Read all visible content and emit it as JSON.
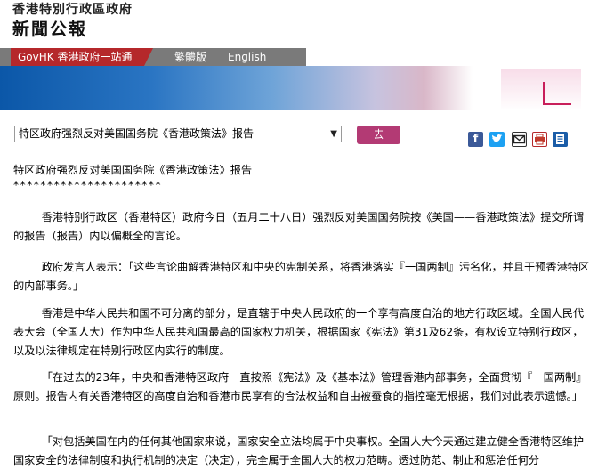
{
  "header": {
    "gov_title": "香港特別行政區政府",
    "press_title": "新聞公報"
  },
  "nav": {
    "govhk": "GovHK 香港政府一站通",
    "trad": "繁體版",
    "english": "English"
  },
  "toolbar": {
    "selected": "特区政府强烈反对美国国务院《香港政策法》报告",
    "go_label": "去"
  },
  "article": {
    "title": "特区政府强烈反对美国国务院《香港政策法》报告",
    "stars": "**********************",
    "paragraphs": [
      "香港特别行政区（香港特区）政府今日（五月二十八日）强烈反对美国国务院按《美国——香港政策法》提交所谓的报告（报告）内以偏概全的言论。",
      "政府发言人表示：「这些言论曲解香港特区和中央的宪制关系，将香港落实『一国两制』污名化，并且干预香港特区的内部事务。」",
      "香港是中华人民共和国不可分离的部分，是直辖于中央人民政府的一个享有高度自治的地方行政区域。全国人民代表大会（全国人大）作为中华人民共和国最高的国家权力机关，根据国家《宪法》第31及62条，有权设立特别行政区，以及以法律规定在特别行政区内实行的制度。",
      "「在过去的23年，中央和香港特区政府一直按照《宪法》及《基本法》管理香港内部事务，全面贯彻『一国两制』原则。报告内有关香港特区的高度自治和香港市民享有的合法权益和自由被蚕食的指控毫无根据，我们对此表示遗憾。」",
      "「对包括美国在内的任何其他国家来说，国家安全立法均属于中央事权。全国人大今天通过建立健全香港特区维护国家安全的法律制度和执行机制的决定（决定），完全属于全国人大的权力范畴。透过防范、制止和惩治任何分"
    ]
  }
}
